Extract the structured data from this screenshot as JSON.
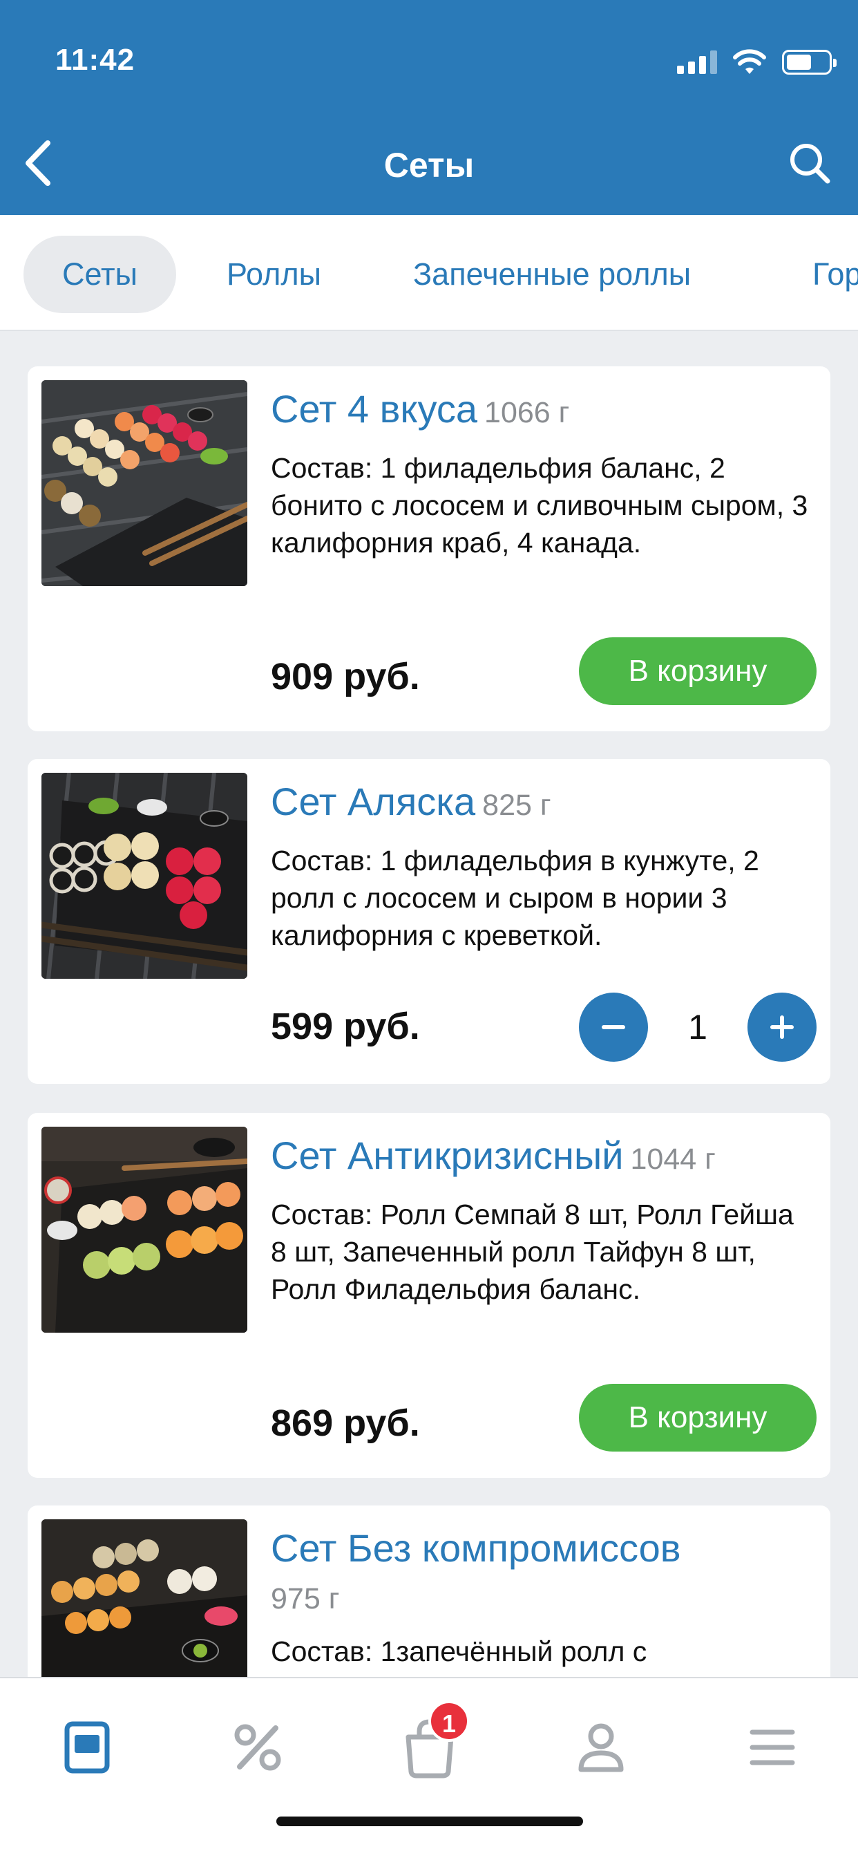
{
  "status_bar": {
    "time": "11:42"
  },
  "header": {
    "title": "Сеты",
    "back_icon": "chevron-left-icon",
    "search_icon": "search-icon"
  },
  "tabs": [
    {
      "label": "Сеты",
      "active": true
    },
    {
      "label": "Роллы",
      "active": false
    },
    {
      "label": "Запеченные роллы",
      "active": false
    },
    {
      "label": "Гор",
      "active": false
    }
  ],
  "products": [
    {
      "name": "Сет 4 вкуса",
      "weight": "1066 г",
      "description": "Состав: 1 филадельфия баланс, 2 бонито с лососем и сливочным сыром, 3 калифорния краб, 4 канада.",
      "price": "909 руб.",
      "cart_label": "В корзину"
    },
    {
      "name": "Сет Аляска",
      "weight": "825 г",
      "description": "Состав: 1 филадельфия в кунжуте, 2 ролл с лососем и сыром в нории 3 калифорния с креветкой.",
      "price": "599 руб.",
      "quantity": "1"
    },
    {
      "name": "Сет Антикризисный",
      "weight": "1044 г",
      "description": "Состав: Ролл Семпай 8 шт, Ролл Гейша 8 шт, Запеченный ролл Тайфун 8 шт, Ролл Филадельфия баланс.",
      "price": "869 руб.",
      "cart_label": "В корзину"
    },
    {
      "name": "Сет Без компромиссов",
      "weight": "975 г",
      "description": "Состав: 1запечённый ролл с"
    }
  ],
  "bottom_nav": {
    "items": [
      {
        "icon": "menu-book-icon",
        "active": true
      },
      {
        "icon": "percent-icon",
        "active": false
      },
      {
        "icon": "cart-bag-icon",
        "badge": "1",
        "active": false
      },
      {
        "icon": "profile-icon",
        "active": false
      },
      {
        "icon": "hamburger-menu-icon",
        "active": false
      }
    ]
  },
  "colors": {
    "primary": "#2a7ab8",
    "accent_green": "#4db848",
    "badge_red": "#e8303b",
    "inactive_icon": "#a8acb1"
  }
}
